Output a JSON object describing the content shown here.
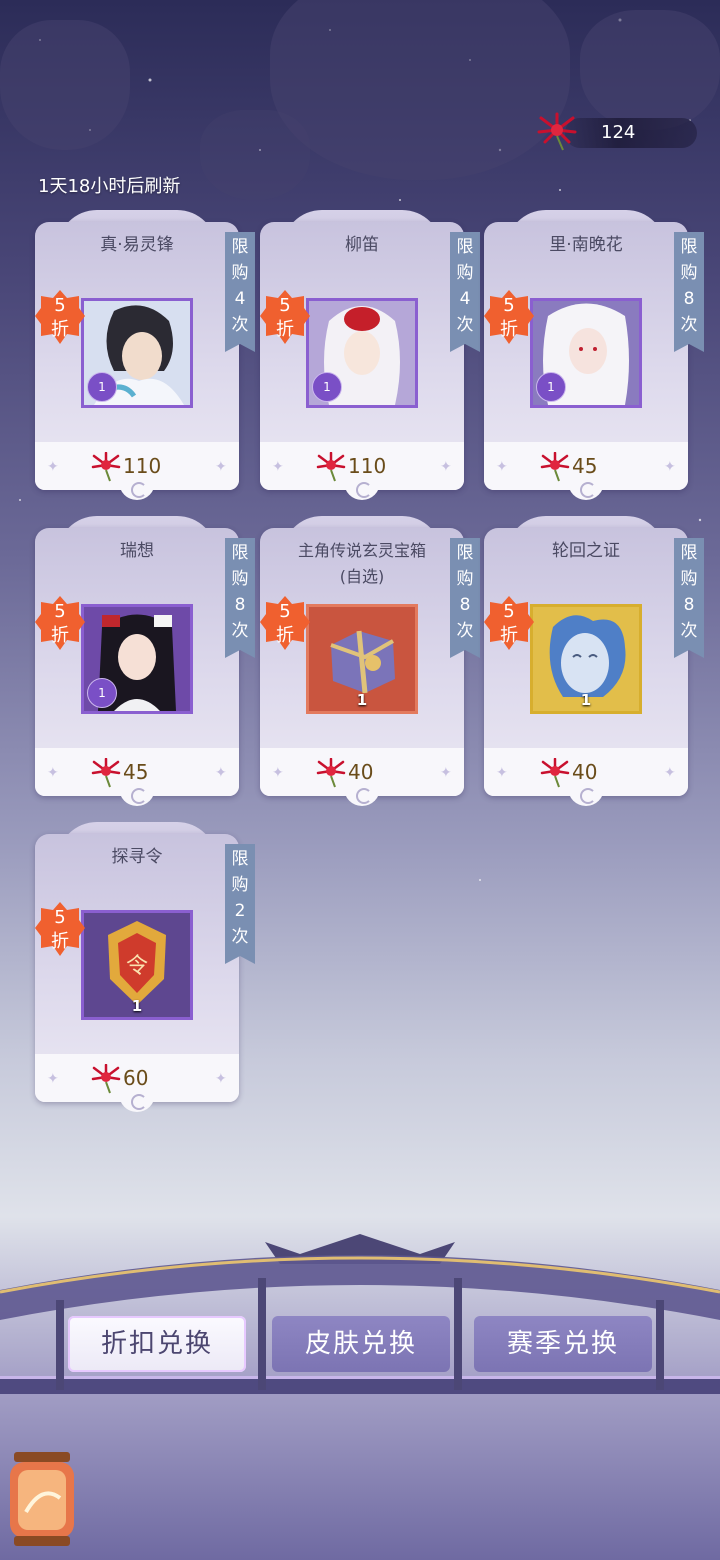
{
  "currency": {
    "icon": "red-spider-lily-icon",
    "amount": "124"
  },
  "refresh_text": "1天18小时后刷新",
  "discount_label": [
    "5",
    "折"
  ],
  "cards": [
    {
      "name": "真·易灵锋",
      "limit": [
        "限",
        "购",
        "4",
        "次"
      ],
      "price": "110",
      "item_type": "character",
      "level": "1"
    },
    {
      "name": "柳笛",
      "limit": [
        "限",
        "购",
        "4",
        "次"
      ],
      "price": "110",
      "item_type": "character",
      "level": "1"
    },
    {
      "name": "里·南晚花",
      "limit": [
        "限",
        "购",
        "8",
        "次"
      ],
      "price": "45",
      "item_type": "character",
      "level": "1"
    },
    {
      "name": "瑞想",
      "limit": [
        "限",
        "购",
        "8",
        "次"
      ],
      "price": "45",
      "item_type": "character",
      "level": "1"
    },
    {
      "name": "主角传说玄灵宝箱(自选)",
      "limit": [
        "限",
        "购",
        "8",
        "次"
      ],
      "price": "40",
      "item_type": "chest",
      "count": "1"
    },
    {
      "name": "轮回之证",
      "limit": [
        "限",
        "购",
        "8",
        "次"
      ],
      "price": "40",
      "item_type": "mask",
      "count": "1"
    },
    {
      "name": "探寻令",
      "limit": [
        "限",
        "购",
        "2",
        "次"
      ],
      "price": "60",
      "item_type": "token",
      "count": "1"
    }
  ],
  "tabs": [
    {
      "label": "折扣兑换",
      "active": true
    },
    {
      "label": "皮肤兑换",
      "active": false
    },
    {
      "label": "赛季兑换",
      "active": false
    }
  ],
  "colors": {
    "limit_tag": "#7a8fb2",
    "discount": "#f0602f",
    "active_tab": "#fbfaff",
    "inactive_tab": "#8e86c3"
  }
}
